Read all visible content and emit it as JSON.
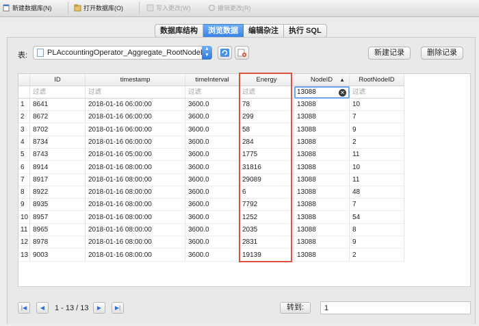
{
  "toolbar": {
    "new_db": "新建数据库(N)",
    "open_db": "打开数据库(O)",
    "write_changes": "写入更改(W)",
    "revert_changes": "撤销更改(R)"
  },
  "tabs": [
    {
      "label": "数据库结构",
      "active": false
    },
    {
      "label": "浏览数据",
      "active": true
    },
    {
      "label": "编辑杂注",
      "active": false
    },
    {
      "label": "执行 SQL",
      "active": false
    }
  ],
  "browse": {
    "table_label": "表:",
    "table_name": "PLAccountingOperator_Aggregate_RootNodeEnergy",
    "new_record": "新建记录",
    "delete_record": "删除记录"
  },
  "grid": {
    "columns": [
      "ID",
      "timestamp",
      "timeInterval",
      "Energy",
      "NodeID",
      "RootNodeID"
    ],
    "filter_placeholder": "过滤",
    "nodeid_filter": "13088",
    "rows": [
      [
        "1",
        "8641",
        "2018-01-16 06:00:00",
        "3600.0",
        "78",
        "13088",
        "10"
      ],
      [
        "2",
        "8672",
        "2018-01-16 06:00:00",
        "3600.0",
        "299",
        "13088",
        "7"
      ],
      [
        "3",
        "8702",
        "2018-01-16 06:00:00",
        "3600.0",
        "58",
        "13088",
        "9"
      ],
      [
        "4",
        "8734",
        "2018-01-16 06:00:00",
        "3600.0",
        "284",
        "13088",
        "2"
      ],
      [
        "5",
        "8743",
        "2018-01-16 05:00:00",
        "3600.0",
        "1775",
        "13088",
        "11"
      ],
      [
        "6",
        "8914",
        "2018-01-16 08:00:00",
        "3600.0",
        "31816",
        "13088",
        "10"
      ],
      [
        "7",
        "8917",
        "2018-01-16 08:00:00",
        "3600.0",
        "29089",
        "13088",
        "11"
      ],
      [
        "8",
        "8922",
        "2018-01-16 08:00:00",
        "3600.0",
        "6",
        "13088",
        "48"
      ],
      [
        "9",
        "8935",
        "2018-01-16 08:00:00",
        "3600.0",
        "7792",
        "13088",
        "7"
      ],
      [
        "10",
        "8957",
        "2018-01-16 08:00:00",
        "3600.0",
        "1252",
        "13088",
        "54"
      ],
      [
        "11",
        "8965",
        "2018-01-16 08:00:00",
        "3600.0",
        "2035",
        "13088",
        "8"
      ],
      [
        "12",
        "8978",
        "2018-01-16 08:00:00",
        "3600.0",
        "2831",
        "13088",
        "9"
      ],
      [
        "13",
        "9003",
        "2018-01-16 08:00:00",
        "3600.0",
        "19139",
        "13088",
        "2"
      ]
    ]
  },
  "pagination": {
    "info": "1 - 13 / 13",
    "goto_label": "转到:",
    "goto_value": "1"
  },
  "icons": {
    "new_db": "new-database-icon",
    "open_db": "open-database-icon",
    "write": "write-changes-icon",
    "revert": "revert-changes-icon",
    "refresh": "refresh-icon",
    "clear_filters": "clear-filters-icon"
  },
  "colors": {
    "accent": "#3a83e5",
    "highlight": "#d9533d"
  }
}
